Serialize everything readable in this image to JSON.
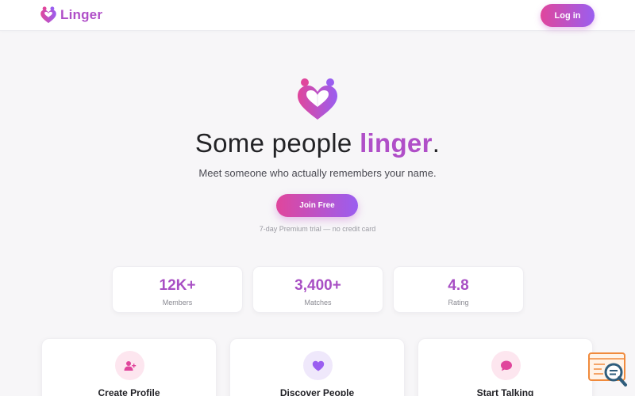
{
  "header": {
    "brand_name": "Linger",
    "login_label": "Log in"
  },
  "hero": {
    "title_prefix": "Some people ",
    "title_accent": "linger",
    "title_suffix": ".",
    "subtitle": "Meet someone who actually remembers your name.",
    "cta_label": "Join Free",
    "note": "7-day Premium trial — no credit card"
  },
  "stats": [
    {
      "value": "12K+",
      "label": "Members"
    },
    {
      "value": "3,400+",
      "label": "Matches"
    },
    {
      "value": "4.8",
      "label": "Rating"
    }
  ],
  "features": [
    {
      "title": "Create Profile",
      "icon": "add-user-icon"
    },
    {
      "title": "Discover People",
      "icon": "heart-icon"
    },
    {
      "title": "Start Talking",
      "icon": "chat-bubble-icon"
    }
  ],
  "colors": {
    "brand": "#b04fc8",
    "gradient_start": "#e0469c",
    "gradient_end": "#9a5ef0",
    "background": "#f7f6f8"
  }
}
